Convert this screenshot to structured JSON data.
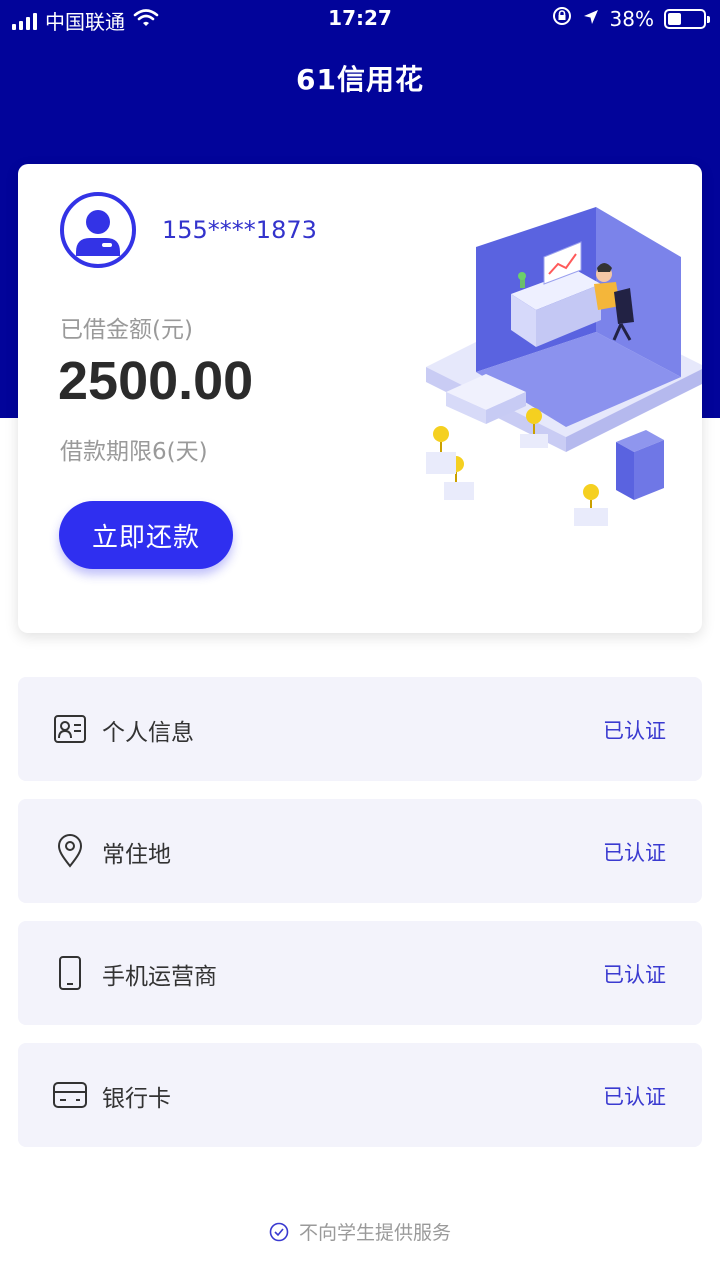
{
  "status_bar": {
    "carrier": "中国联通",
    "time": "17:27",
    "battery": "38%",
    "battery_level": 0.38,
    "icons": [
      "signal-icon",
      "wifi-icon",
      "rotation-lock-icon",
      "location-icon",
      "battery-icon"
    ]
  },
  "header": {
    "title": "61信用花"
  },
  "card": {
    "phone": "155****1873",
    "borrowed_label": "已借金额(元)",
    "amount": "2500.00",
    "term": "借款期限6(天)",
    "repay_button": "立即还款"
  },
  "verification_items": [
    {
      "label": "个人信息",
      "status": "已认证",
      "icon": "id-card-icon"
    },
    {
      "label": "常住地",
      "status": "已认证",
      "icon": "location-pin-icon"
    },
    {
      "label": "手机运营商",
      "status": "已认证",
      "icon": "mobile-phone-icon"
    },
    {
      "label": "银行卡",
      "status": "已认证",
      "icon": "bank-card-icon"
    }
  ],
  "footer": {
    "notice": "不向学生提供服务"
  },
  "colors": {
    "brand": "#02049a",
    "accent": "#2f2ff0",
    "item_bg": "#f3f3fb",
    "status_text": "#3a3ad0"
  }
}
